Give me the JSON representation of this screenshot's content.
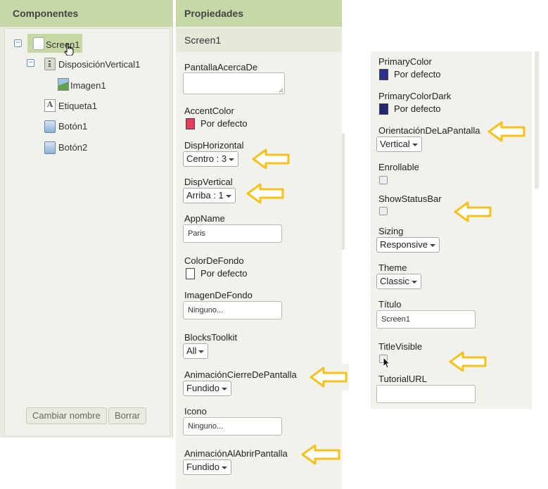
{
  "components": {
    "title": "Componentes",
    "tree": [
      {
        "label": "Screen1",
        "icon": "screen-icon"
      },
      {
        "label": "DisposiciónVertical1",
        "icon": "vertical-arrangement-icon"
      },
      {
        "label": "Imagen1",
        "icon": "image-icon"
      },
      {
        "label": "Etiqueta1",
        "icon": "label-icon"
      },
      {
        "label": "Botón1",
        "icon": "button-icon"
      },
      {
        "label": "Botón2",
        "icon": "button-icon"
      }
    ],
    "rename_label": "Cambiar nombre",
    "delete_label": "Borrar"
  },
  "properties": {
    "title": "Propiedades",
    "selected_component": "Screen1",
    "col1": {
      "about_screen": {
        "label": "PantallaAcercaDe",
        "value": ""
      },
      "accent_color": {
        "label": "AccentColor",
        "value": "Por defecto",
        "color": "#e8385c"
      },
      "align_horizontal": {
        "label": "DispHorizontal",
        "value": "Centro : 3"
      },
      "align_vertical": {
        "label": "DispVertical",
        "value": "Arriba : 1"
      },
      "app_name": {
        "label": "AppName",
        "value": "Paris"
      },
      "background_color": {
        "label": "ColorDeFondo",
        "value": "Por defecto",
        "color": "#ffffff"
      },
      "background_image": {
        "label": "ImagenDeFondo",
        "value": "Ninguno..."
      },
      "blocks_toolkit": {
        "label": "BlocksToolkit",
        "value": "All"
      },
      "close_screen_animation": {
        "label": "AnimaciónCierreDePantalla",
        "value": "Fundido"
      },
      "icon": {
        "label": "Icono",
        "value": "Ninguno..."
      },
      "open_screen_animation": {
        "label": "AnimaciónAlAbrirPantalla",
        "value": "Fundido"
      }
    },
    "col2": {
      "primary_color": {
        "label": "PrimaryColor",
        "value": "Por defecto",
        "color": "#2b2f8f"
      },
      "primary_color_dark": {
        "label": "PrimaryColorDark",
        "value": "Por defecto",
        "color": "#232672"
      },
      "screen_orientation": {
        "label": "OrientaciónDeLaPantalla",
        "value": "Vertical"
      },
      "scrollable": {
        "label": "Enrollable"
      },
      "show_status_bar": {
        "label": "ShowStatusBar"
      },
      "sizing": {
        "label": "Sizing",
        "value": "Responsive"
      },
      "theme": {
        "label": "Theme",
        "value": "Classic"
      },
      "title": {
        "label": "Título",
        "value": "Screen1"
      },
      "title_visible": {
        "label": "TitleVisible"
      },
      "tutorial_url": {
        "label": "TutorialURL",
        "value": ""
      }
    }
  },
  "colors": {
    "header_green": "#c6d7a8",
    "arrow_yellow": "#f5c21b"
  }
}
